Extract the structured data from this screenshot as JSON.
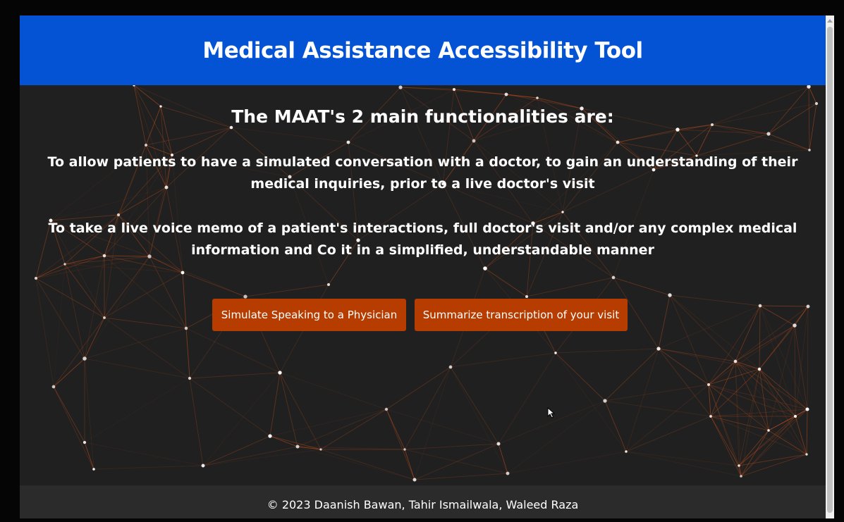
{
  "header": {
    "title": "Medical Assistance Accessibility Tool"
  },
  "main": {
    "subtitle": "The MAAT's 2 main functionalities are:",
    "paragraphs": [
      "To allow patients to have a simulated conversation with a doctor, to gain an understanding of their medical inquiries, prior to a live doctor's visit",
      "To take a live voice memo of a patient's interactions, full doctor's visit and/or any complex medical information and Co it in a simplified, understandable manner"
    ],
    "buttons": {
      "simulate_label": "Simulate Speaking to a Physician",
      "summarize_label": "Summarize transcription of your visit"
    }
  },
  "footer": {
    "copyright": "© 2023 Daanish Bawan, Tahir Ismailwala, Waleed Raza"
  },
  "colors": {
    "header_bg": "#0353d4",
    "body_bg": "#202020",
    "button_bg": "#b63c00",
    "network_line": "#c4501a",
    "network_node": "#ffffff",
    "footer_bg": "#2b2b2b"
  },
  "icons": {
    "cursor": "mouse-pointer-icon",
    "scroll_up": "scroll-up-arrow-icon"
  }
}
